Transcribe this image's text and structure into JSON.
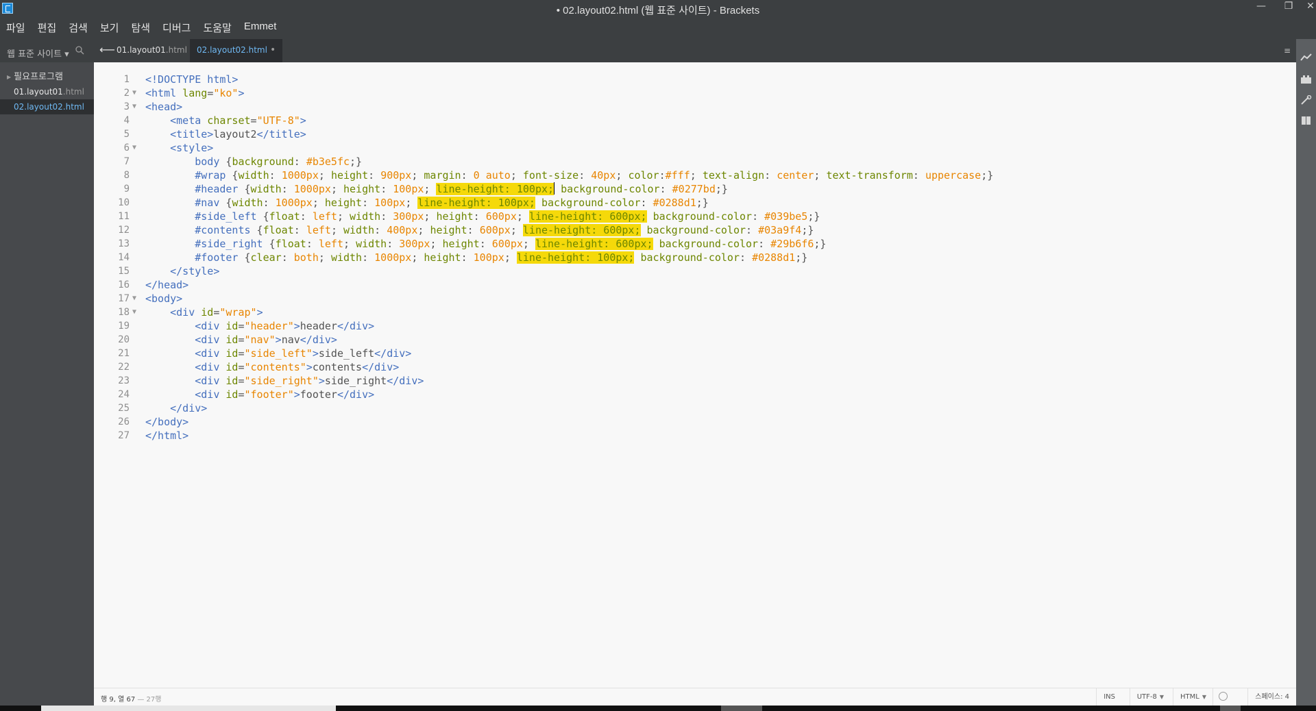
{
  "window": {
    "title": "• 02.layout02.html (웹 표준 사이트) - Brackets",
    "minimize": "—",
    "restore": "❐",
    "close": "✕"
  },
  "menu": [
    "파일",
    "편집",
    "검색",
    "보기",
    "탐색",
    "디버그",
    "도움말",
    "Emmet"
  ],
  "sidebar": {
    "project_title": "웹 표준 사이트 ▾",
    "folder": "필요프로그램",
    "files": [
      {
        "name": "01.layout01",
        "ext": ".html"
      },
      {
        "name": "02.layout02",
        "ext": ".html"
      }
    ]
  },
  "tabs": {
    "back": "⟵",
    "items": [
      {
        "name": "01.layout01",
        "ext": ".html"
      },
      {
        "name": "02.layout02",
        "ext": ".html",
        "dirty": "•"
      }
    ],
    "split": "≡"
  },
  "editor": {
    "line_numbers": [
      "1",
      "2",
      "3",
      "4",
      "5",
      "6",
      "7",
      "8",
      "9",
      "10",
      "11",
      "12",
      "13",
      "14",
      "15",
      "16",
      "17",
      "18",
      "19",
      "20",
      "21",
      "22",
      "23",
      "24",
      "25",
      "26",
      "27"
    ],
    "fold_marker": "▼",
    "tokens": {
      "l1": "<!DOCTYPE html>",
      "l2a": "<html",
      "l2b": " lang",
      "l2c": "=",
      "l2d": "\"ko\"",
      "l2e": ">",
      "l3": "<head>",
      "l4a": "    <meta",
      "l4b": " charset",
      "l4c": "=",
      "l4d": "\"UTF-8\"",
      "l4e": ">",
      "l5a": "    <title>",
      "l5b": "layout2",
      "l5c": "</title>",
      "l6": "    <style>",
      "l7a": "        body",
      "l7b": " {",
      "l7c": "background",
      "l7d": ": ",
      "l7e": "#b3e5fc",
      "l7f": ";}",
      "l8a": "        #wrap",
      "l8b": " {",
      "l8c": "width",
      "l8d": ": ",
      "l8e": "1000px",
      "l8f": "; ",
      "l8g": "height",
      "l8h": ": ",
      "l8i": "900px",
      "l8j": "; ",
      "l8k": "margin",
      "l8l": ": ",
      "l8m": "0 auto",
      "l8n": "; ",
      "l8o": "font-size",
      "l8p": ": ",
      "l8q": "40px",
      "l8r": "; ",
      "l8s": "color",
      "l8t": ":",
      "l8u": "#fff",
      "l8v": "; ",
      "l8w": "text-align",
      "l8x": ": ",
      "l8y": "center",
      "l8z": "; ",
      "l8aa": "text-transform",
      "l8ab": ": ",
      "l8ac": "uppercase",
      "l8ad": ";}",
      "l9a": "        #header",
      "l9b": " {",
      "l9c": "width",
      "l9d": ": ",
      "l9e": "1000px",
      "l9f": "; ",
      "l9g": "height",
      "l9h": ": ",
      "l9i": "100px",
      "l9j": "; ",
      "l9k": "line-height: 100px;",
      "l9l": " ",
      "l9m": "background-color",
      "l9n": ": ",
      "l9o": "#0277bd",
      "l9p": ";}",
      "l10a": "        #nav",
      "l10b": " {",
      "l10c": "width",
      "l10d": ": ",
      "l10e": "1000px",
      "l10f": "; ",
      "l10g": "height",
      "l10h": ": ",
      "l10i": "100px",
      "l10j": "; ",
      "l10k": "line-height: 100px;",
      "l10l": " ",
      "l10m": "background-color",
      "l10n": ": ",
      "l10o": "#0288d1",
      "l10p": ";}",
      "l11a": "        #side_left",
      "l11b": " {",
      "l11c": "float",
      "l11d": ": ",
      "l11e": "left",
      "l11f": "; ",
      "l11g": "width",
      "l11h": ": ",
      "l11i": "300px",
      "l11j": "; ",
      "l11k": "height",
      "l11l": ": ",
      "l11m": "600px",
      "l11n": "; ",
      "l11o": "line-height: 600px;",
      "l11p": " ",
      "l11q": "background-color",
      "l11r": ": ",
      "l11s": "#039be5",
      "l11t": ";}",
      "l12a": "        #contents",
      "l12b": " {",
      "l12c": "float",
      "l12d": ": ",
      "l12e": "left",
      "l12f": "; ",
      "l12g": "width",
      "l12h": ": ",
      "l12i": "400px",
      "l12j": "; ",
      "l12k": "height",
      "l12l": ": ",
      "l12m": "600px",
      "l12n": "; ",
      "l12o": "line-height: 600px;",
      "l12p": " ",
      "l12q": "background-color",
      "l12r": ": ",
      "l12s": "#03a9f4",
      "l12t": ";}",
      "l13a": "        #side_right",
      "l13b": " {",
      "l13c": "float",
      "l13d": ": ",
      "l13e": "left",
      "l13f": "; ",
      "l13g": "width",
      "l13h": ": ",
      "l13i": "300px",
      "l13j": "; ",
      "l13k": "height",
      "l13l": ": ",
      "l13m": "600px",
      "l13n": "; ",
      "l13o": "line-height: 600px;",
      "l13p": " ",
      "l13q": "background-color",
      "l13r": ": ",
      "l13s": "#29b6f6",
      "l13t": ";}",
      "l14a": "        #footer",
      "l14b": " {",
      "l14c": "clear",
      "l14d": ": ",
      "l14e": "both",
      "l14f": "; ",
      "l14g": "width",
      "l14h": ": ",
      "l14i": "1000px",
      "l14j": "; ",
      "l14k": "height",
      "l14l": ": ",
      "l14m": "100px",
      "l14n": "; ",
      "l14o": "line-height: 100px;",
      "l14p": " ",
      "l14q": "background-color",
      "l14r": ": ",
      "l14s": "#0288d1",
      "l14t": ";}",
      "l15": "    </style>",
      "l16": "</head>",
      "l17": "<body>",
      "l18a": "    <div",
      "l18b": " id",
      "l18c": "=",
      "l18d": "\"wrap\"",
      "l18e": ">",
      "l19a": "        <div",
      "l19b": " id",
      "l19c": "=",
      "l19d": "\"header\"",
      "l19e": ">",
      "l19f": "header",
      "l19g": "</div>",
      "l20a": "        <div",
      "l20b": " id",
      "l20c": "=",
      "l20d": "\"nav\"",
      "l20e": ">",
      "l20f": "nav",
      "l20g": "</div>",
      "l21a": "        <div",
      "l21b": " id",
      "l21c": "=",
      "l21d": "\"side_left\"",
      "l21e": ">",
      "l21f": "side_left",
      "l21g": "</div>",
      "l22a": "        <div",
      "l22b": " id",
      "l22c": "=",
      "l22d": "\"contents\"",
      "l22e": ">",
      "l22f": "contents",
      "l22g": "</div>",
      "l23a": "        <div",
      "l23b": " id",
      "l23c": "=",
      "l23d": "\"side_right\"",
      "l23e": ">",
      "l23f": "side_right",
      "l23g": "</div>",
      "l24a": "        <div",
      "l24b": " id",
      "l24c": "=",
      "l24d": "\"footer\"",
      "l24e": ">",
      "l24f": "footer",
      "l24g": "</div>",
      "l25": "    </div>",
      "l26": "</body>",
      "l27": "</html>"
    }
  },
  "statusbar": {
    "cursor": "행 9, 열 67",
    "line_count": " — 27행",
    "ins": "INS",
    "encoding": "UTF-8",
    "language": "HTML",
    "indent": "스페이스: 4"
  },
  "colors": {
    "tag": "#446fbd",
    "attribute": "#6d8600",
    "string": "#e88501",
    "highlight": "#f5d90a"
  },
  "right_toolbar_icons": [
    "live-preview-icon",
    "extension-manager-icon",
    "tools-icon",
    "book-icon"
  ]
}
